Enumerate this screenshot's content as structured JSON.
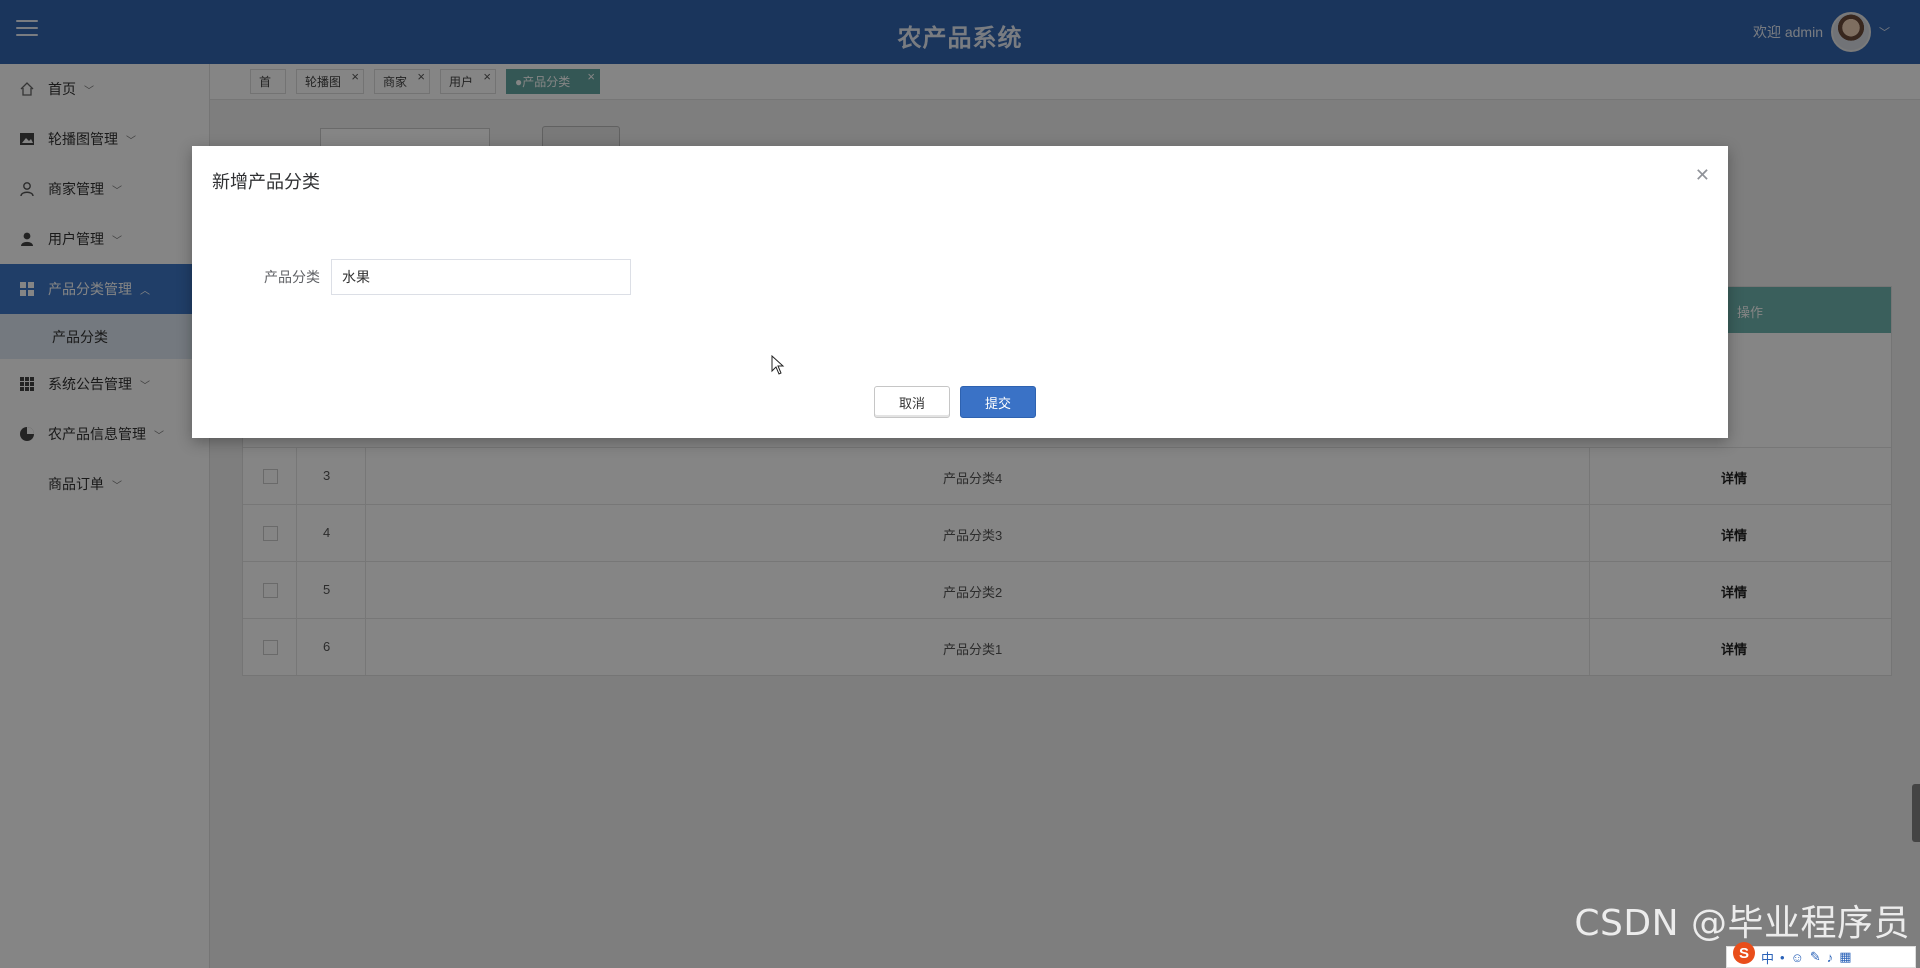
{
  "header": {
    "title": "农产品系统",
    "welcome": "欢迎 admin"
  },
  "sidebar": {
    "items": [
      {
        "label": "首页",
        "icon": "home-icon"
      },
      {
        "label": "轮播图管理",
        "icon": "image-icon"
      },
      {
        "label": "商家管理",
        "icon": "user-outline-icon"
      },
      {
        "label": "用户管理",
        "icon": "user-icon"
      },
      {
        "label": "产品分类管理",
        "icon": "grid-icon",
        "active": true
      },
      {
        "label": "系统公告管理",
        "icon": "apps-icon"
      },
      {
        "label": "农产品信息管理",
        "icon": "pie-icon"
      },
      {
        "label": "商品订单",
        "icon": ""
      }
    ],
    "sub_item": "产品分类"
  },
  "tabs": [
    {
      "label": "首页"
    },
    {
      "label": "轮播图"
    },
    {
      "label": "商家"
    },
    {
      "label": "用户"
    },
    {
      "label": "●产品分类",
      "active": true
    }
  ],
  "table": {
    "op_header": "操作",
    "detail_label": "详情",
    "rows": [
      {
        "index": "3",
        "name": "产品分类4"
      },
      {
        "index": "4",
        "name": "产品分类3"
      },
      {
        "index": "5",
        "name": "产品分类2"
      },
      {
        "index": "6",
        "name": "产品分类1"
      }
    ]
  },
  "modal": {
    "title": "新增产品分类",
    "field_label": "产品分类",
    "field_value": "水果",
    "cancel_label": "取消",
    "submit_label": "提交"
  },
  "watermark": "CSDN @毕业程序员",
  "ime": {
    "mode": "中"
  },
  "colors": {
    "header": "#3366b0",
    "active_nav": "#3e78c8",
    "table_head": "#6fb6b0",
    "submit": "#3a72c6"
  }
}
